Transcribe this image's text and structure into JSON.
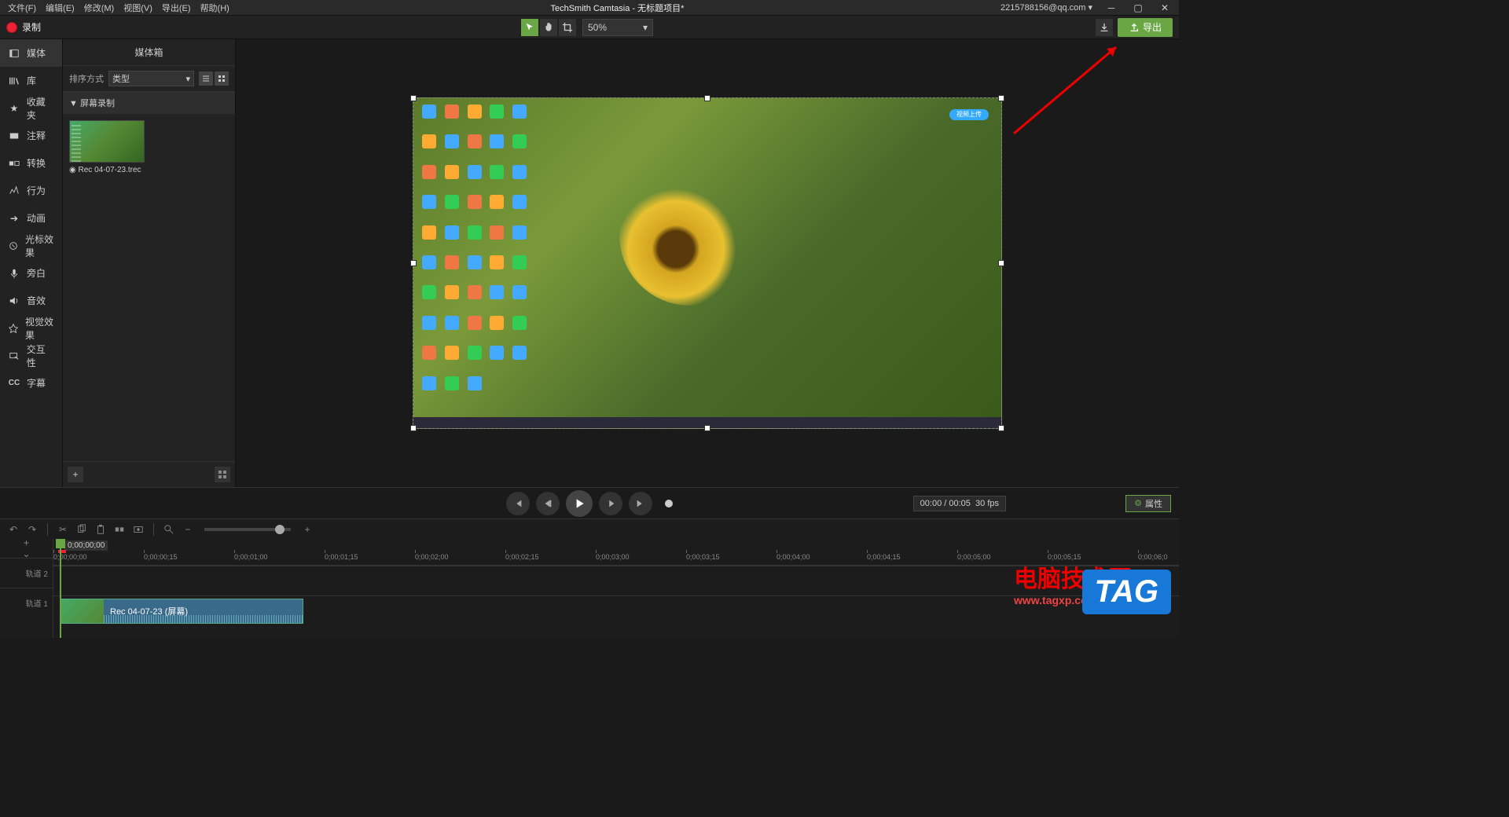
{
  "menubar": {
    "file": "文件(F)",
    "edit": "编辑(E)",
    "modify": "修改(M)",
    "view": "视图(V)",
    "export": "导出(E)",
    "help": "帮助(H)",
    "title": "TechSmith Camtasia - 无标题项目*",
    "account": "2215788156@qq.com"
  },
  "toolbar": {
    "record": "录制",
    "zoom": "50%",
    "export_btn": "导出"
  },
  "sidebar": {
    "items": [
      {
        "label": "媒体"
      },
      {
        "label": "库"
      },
      {
        "label": "收藏夹"
      },
      {
        "label": "注释"
      },
      {
        "label": "转换"
      },
      {
        "label": "行为"
      },
      {
        "label": "动画"
      },
      {
        "label": "光标效果"
      },
      {
        "label": "旁白"
      },
      {
        "label": "音效"
      },
      {
        "label": "视觉效果"
      },
      {
        "label": "交互性"
      },
      {
        "label": "字幕"
      }
    ]
  },
  "media_panel": {
    "title": "媒体箱",
    "sort_label": "排序方式",
    "sort_value": "类型",
    "folder": "▼ 屏幕录制",
    "clip_name": "Rec 04-07-23.trec"
  },
  "canvas": {
    "cloud_badge": "视频上传"
  },
  "playback": {
    "time": "00:00 / 00:05",
    "fps": "30 fps",
    "properties": "属性"
  },
  "timeline": {
    "playhead": "0;00;00;00",
    "track2": "轨道 2",
    "track1": "轨道 1",
    "clip_label": "Rec 04-07-23 (屏幕)",
    "ticks": [
      "0;00;00;00",
      "0;00;00;15",
      "0;00;01;00",
      "0;00;01;15",
      "0;00;02;00",
      "0;00;02;15",
      "0;00;03;00",
      "0;00;03;15",
      "0;00;04;00",
      "0;00;04;15",
      "0;00;05;00",
      "0;00;05;15",
      "0;00;06;0"
    ]
  },
  "watermark": {
    "text": "电脑技术网",
    "url": "www.tagxp.com",
    "tag": "TAG"
  }
}
